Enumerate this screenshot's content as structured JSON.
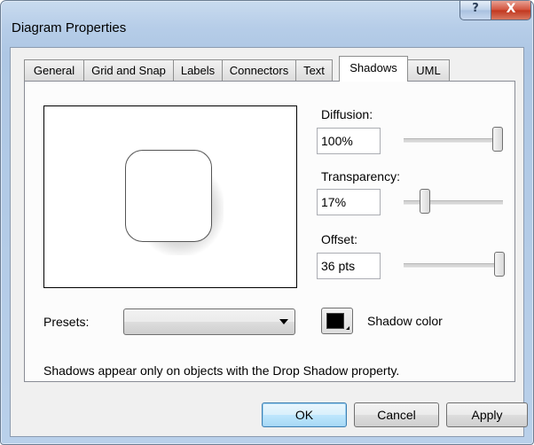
{
  "window": {
    "title": "Diagram Properties",
    "help_label": "?",
    "close_label": "X"
  },
  "tabs": [
    {
      "label": "General"
    },
    {
      "label": "Grid and Snap"
    },
    {
      "label": "Labels"
    },
    {
      "label": "Connectors"
    },
    {
      "label": "Text"
    },
    {
      "label": "Shadows",
      "active": true
    },
    {
      "label": "UML"
    }
  ],
  "shadows": {
    "diffusion": {
      "label": "Diffusion:",
      "value": "100%",
      "slider_fraction": 1.0
    },
    "transparency": {
      "label": "Transparency:",
      "value": "17%",
      "slider_fraction": 0.17
    },
    "offset": {
      "label": "Offset:",
      "value": "36 pts",
      "slider_fraction": 1.0
    },
    "presets": {
      "label": "Presets:",
      "selected": ""
    },
    "shadow_color": {
      "label": "Shadow color",
      "color": "#000000"
    },
    "note": "Shadows appear only on objects with the Drop Shadow property."
  },
  "buttons": {
    "ok": "OK",
    "cancel": "Cancel",
    "apply": "Apply"
  }
}
